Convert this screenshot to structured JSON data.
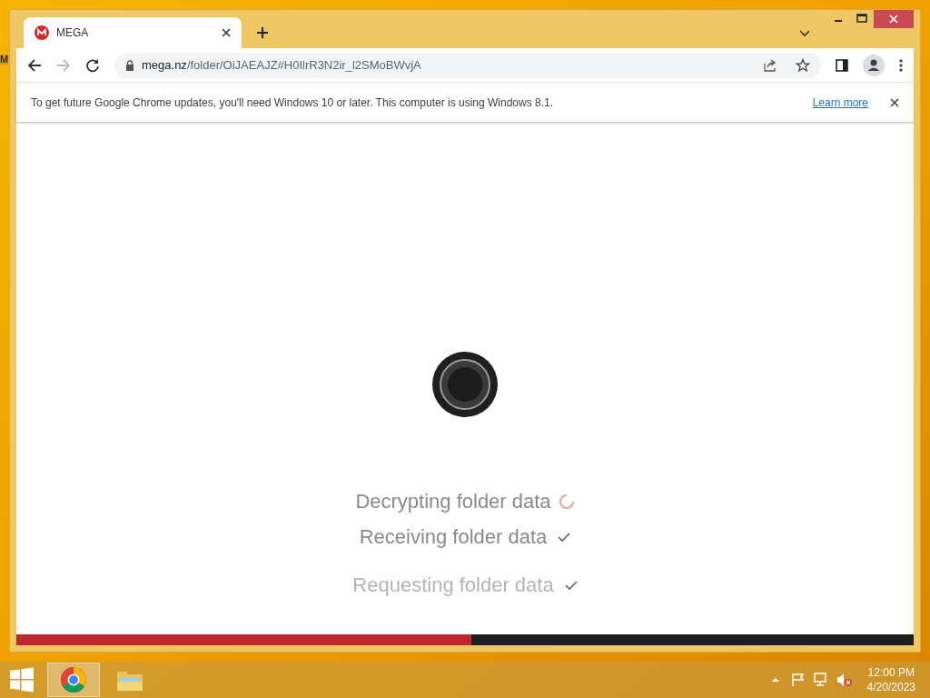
{
  "desktop": {
    "icon_label": "M"
  },
  "tab": {
    "title": "MEGA",
    "selected": true
  },
  "address": {
    "host": "mega.nz",
    "path": "/folder/OiJAEAJZ#H0IlrR3N2ir_l2SMoBWvjA"
  },
  "infobar": {
    "message": "To get future Google Chrome updates, you'll need Windows 10 or later. This computer is using Windows 8.1.",
    "link": "Learn more"
  },
  "steps": [
    {
      "label": "Decrypting folder data",
      "kind": "loading",
      "faded": false
    },
    {
      "label": "Receiving folder data",
      "kind": "done",
      "faded": false
    },
    {
      "label": "Requesting folder data",
      "kind": "done",
      "faded": true
    }
  ],
  "progress": {
    "level": 0.507
  },
  "taskbar": {
    "apps": [
      {
        "kind": "browser",
        "selected": true
      },
      {
        "kind": "files",
        "selected": false
      }
    ],
    "time": "12:00 PM",
    "date": "4/20/2023"
  }
}
